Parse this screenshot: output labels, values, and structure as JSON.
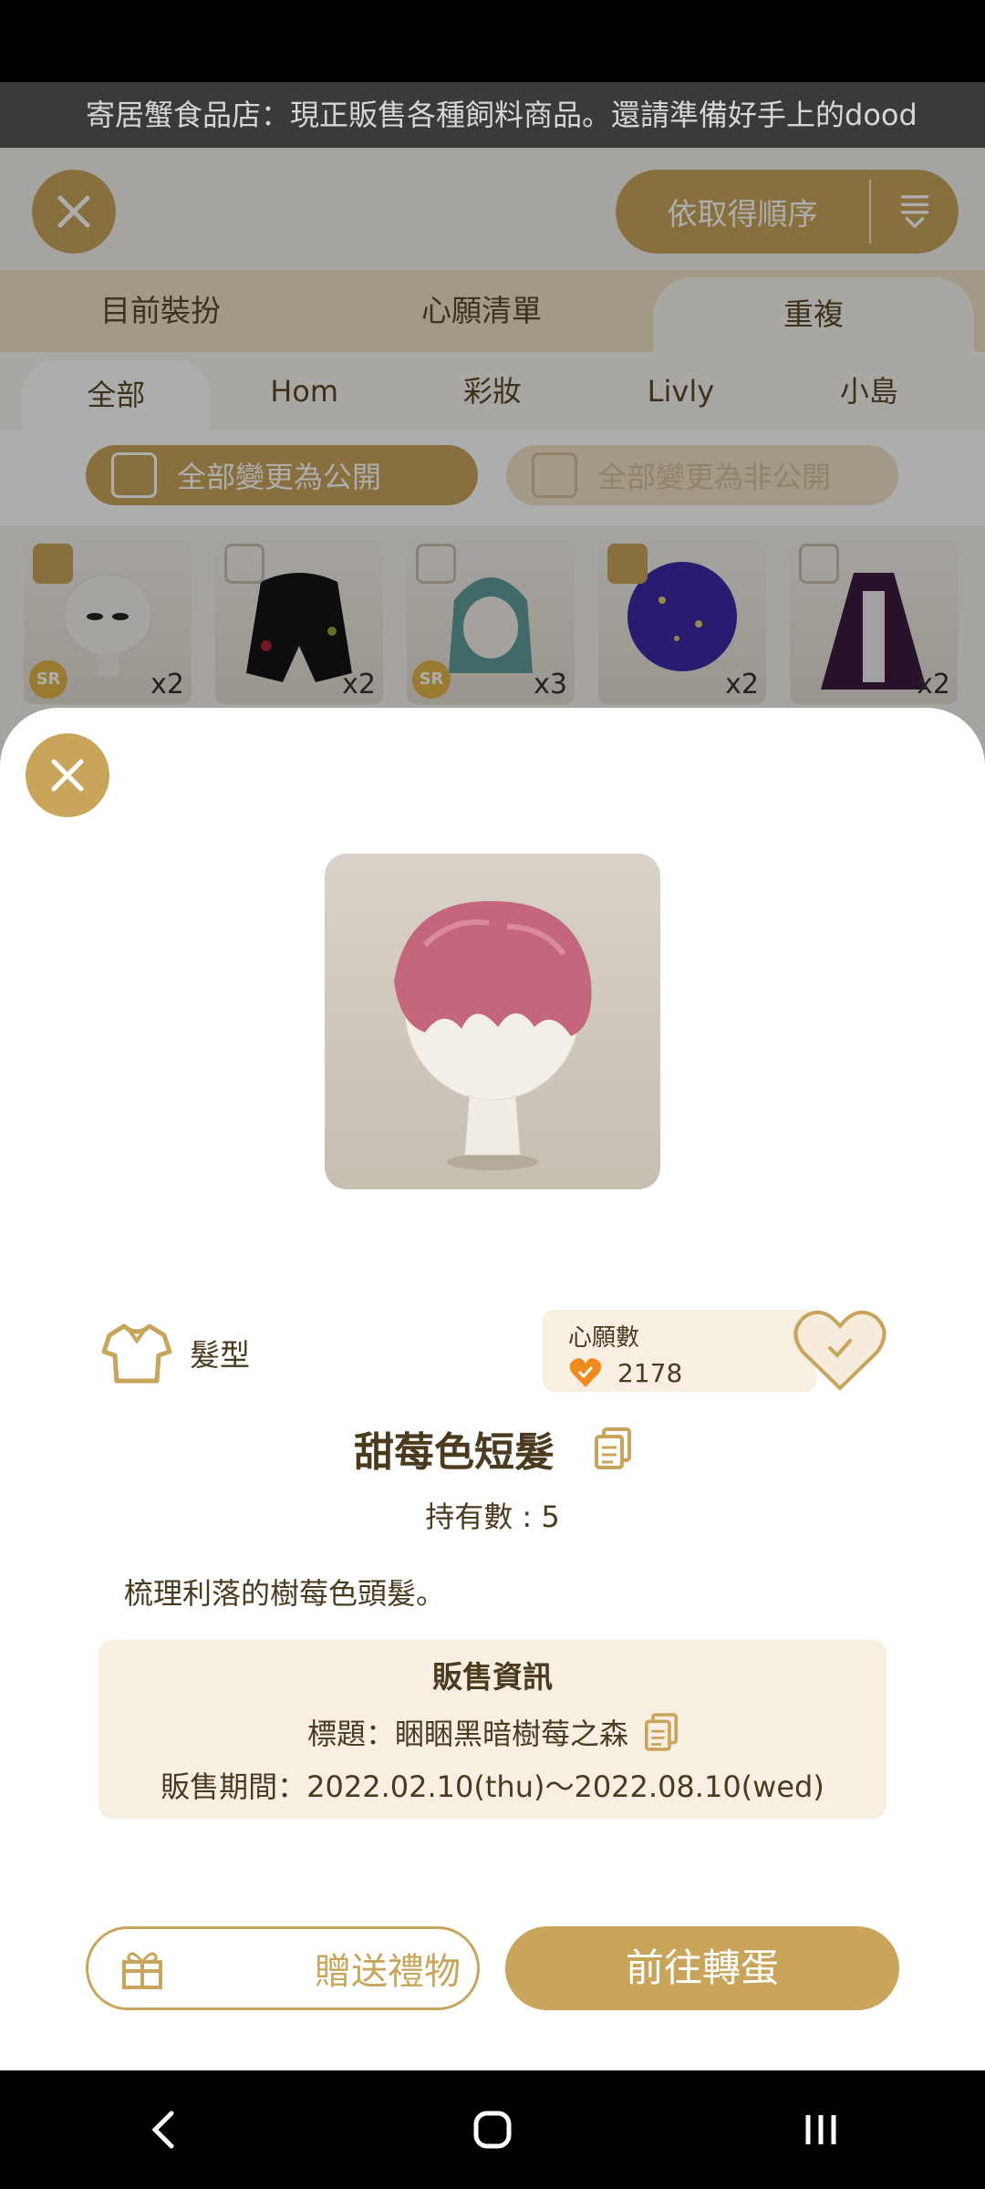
{
  "ticker": {
    "text": "寄居蟹食品店：現正販售各種飼料商品。還請準備好手上的dood"
  },
  "header": {
    "sort_label": "依取得順序"
  },
  "tabs_primary": [
    "目前裝扮",
    "心願清單",
    "重複"
  ],
  "tabs_secondary": [
    "全部",
    "Hom",
    "彩妝",
    "Livly",
    "小島"
  ],
  "visibility": {
    "public_label": "全部變更為公開",
    "private_label": "全部變更為非公開"
  },
  "items": [
    {
      "checked": true,
      "badge": "SR",
      "count": "x2"
    },
    {
      "checked": false,
      "badge": "",
      "count": "x2"
    },
    {
      "checked": false,
      "badge": "SR",
      "count": "x3"
    },
    {
      "checked": true,
      "badge": "",
      "count": "x2"
    },
    {
      "checked": false,
      "badge": "",
      "count": "x2"
    }
  ],
  "detail": {
    "category": "髮型",
    "wishlist_label": "心願數",
    "wishlist_count": "2178",
    "name": "甜莓色短髮",
    "owned": "持有數 : 5",
    "description": "梳理利落的樹莓色頭髮。",
    "sale": {
      "heading": "販售資訊",
      "title": "標題：睏睏黑暗樹莓之森",
      "period": "販售期間：2022.02.10(thu)～2022.08.10(wed)"
    },
    "gift_label": "贈送禮物",
    "gacha_label": "前往轉蛋"
  },
  "colors": {
    "accent": "#c8a55a",
    "panel": "#f7f0e2",
    "text": "#4a3a1e"
  }
}
